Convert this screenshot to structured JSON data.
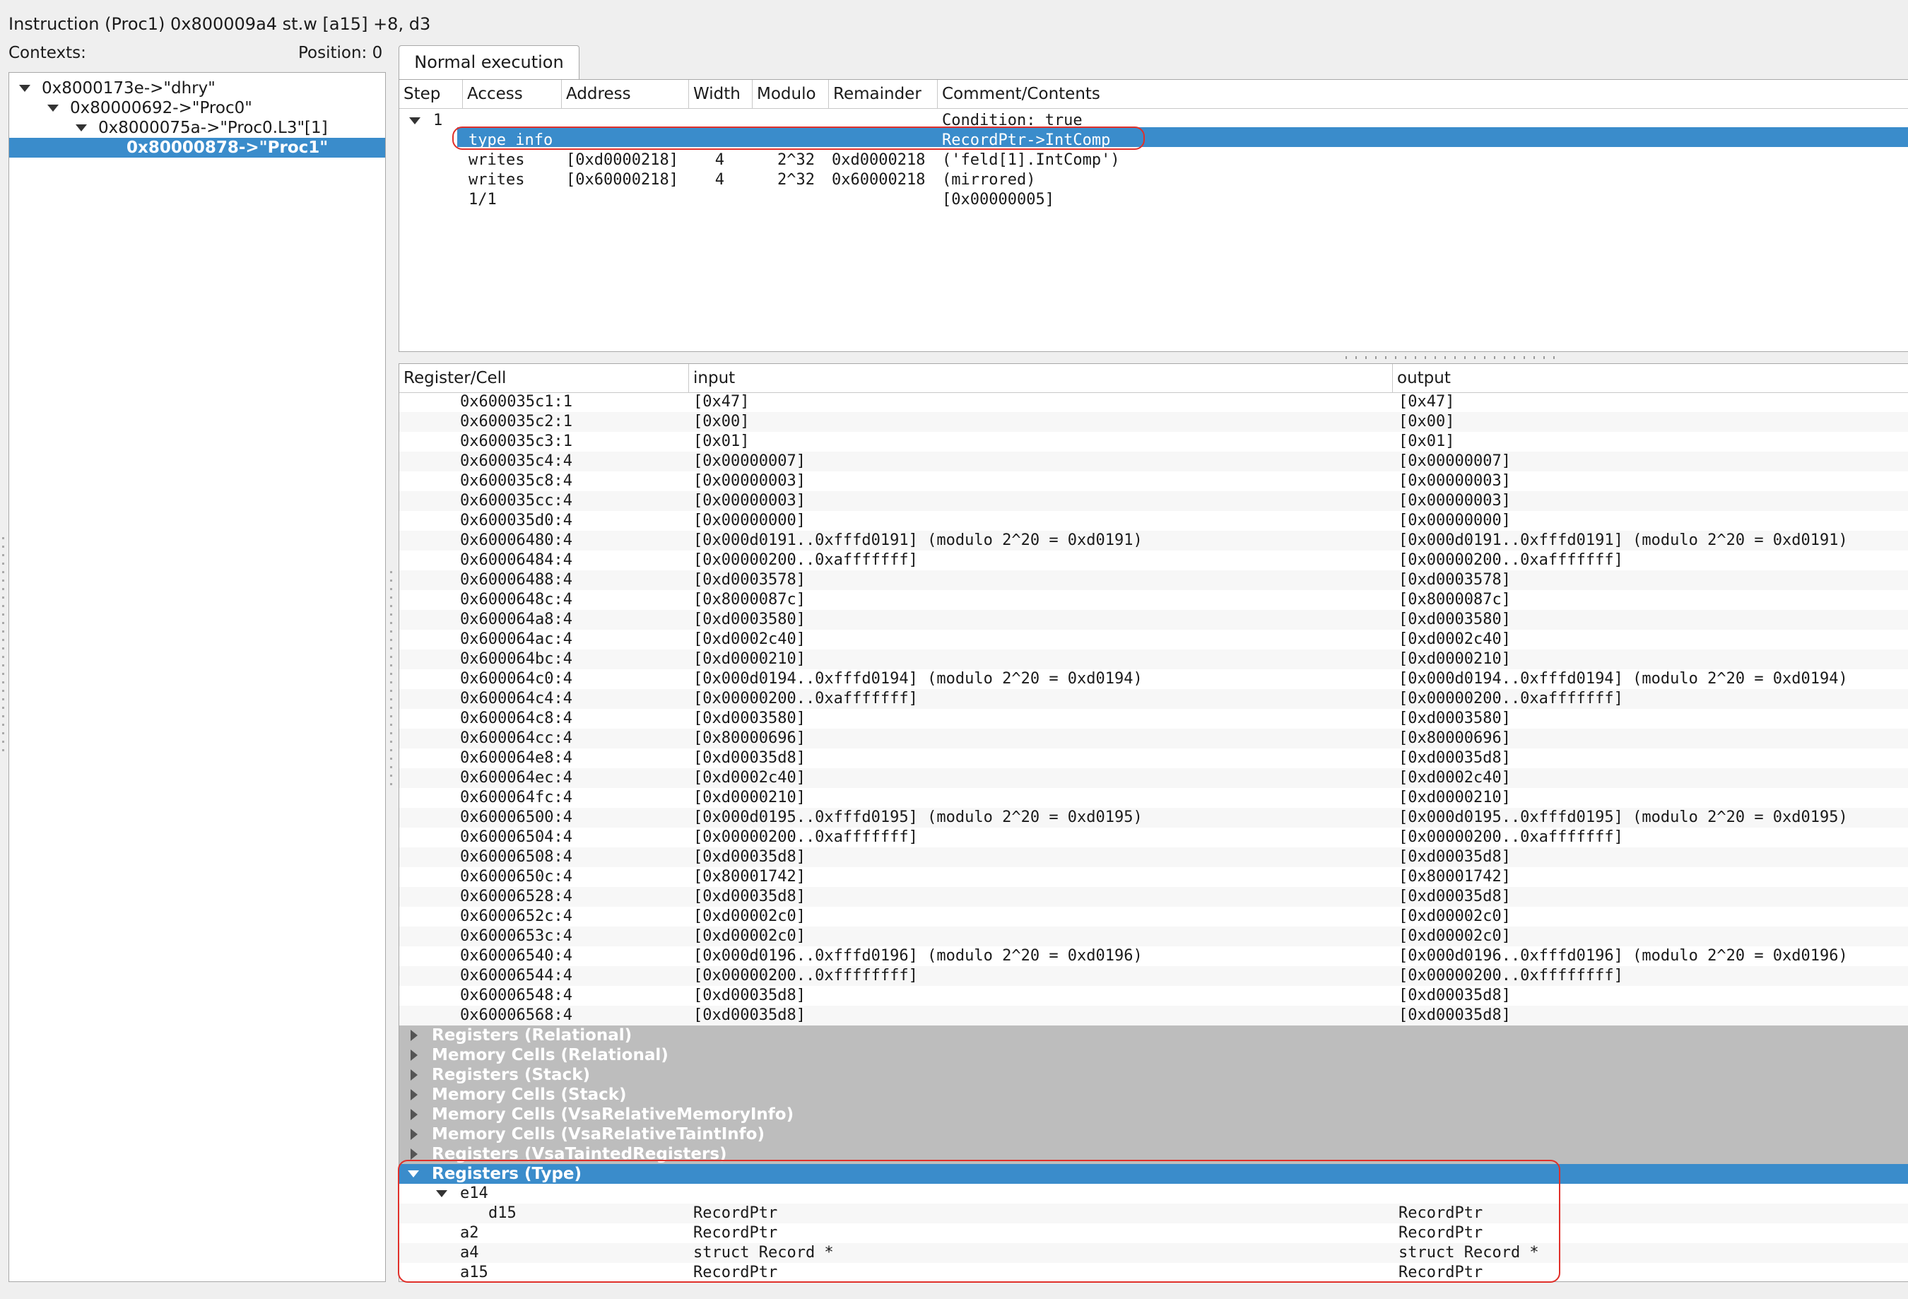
{
  "window": {
    "title": "Instruction (Proc1) 0x800009a4 st.w [a15] +8, d3",
    "contexts_label": "Contexts:",
    "position_label": "Position: 0"
  },
  "contexts": [
    {
      "label": "0x8000173e->\"dhry\"",
      "depth": 0,
      "expanded": true,
      "selected": false
    },
    {
      "label": "0x80000692->\"Proc0\"",
      "depth": 1,
      "expanded": true,
      "selected": false
    },
    {
      "label": "0x8000075a->\"Proc0.L3\"[1]",
      "depth": 2,
      "expanded": true,
      "selected": false
    },
    {
      "label": "0x80000878->\"Proc1\"",
      "depth": 3,
      "expanded": false,
      "selected": true
    }
  ],
  "tab": {
    "label": "Normal execution"
  },
  "steps_table": {
    "headers": [
      "Step",
      "Access",
      "Address",
      "Width",
      "Modulo",
      "Remainder",
      "Comment/Contents"
    ],
    "rows": [
      {
        "step": "1",
        "access": "",
        "address": "",
        "width": "",
        "modulo": "",
        "remainder": "",
        "comment": "Condition: true",
        "expanded": true,
        "selected": false
      },
      {
        "step": "",
        "access": "type info",
        "address": "",
        "width": "",
        "modulo": "",
        "remainder": "",
        "comment": "RecordPtr->IntComp",
        "selected": true
      },
      {
        "step": "",
        "access": "writes",
        "address": "[0xd0000218]",
        "width": "4",
        "modulo": "2^32",
        "remainder": "0xd0000218",
        "comment": "('feld[1].IntComp')",
        "selected": false
      },
      {
        "step": "",
        "access": "writes",
        "address": "[0x60000218]",
        "width": "4",
        "modulo": "2^32",
        "remainder": "0x60000218",
        "comment": "(mirrored)",
        "selected": false
      },
      {
        "step": "",
        "access": "1/1",
        "address": "",
        "width": "",
        "modulo": "",
        "remainder": "",
        "comment": "[0x00000005]",
        "selected": false
      }
    ]
  },
  "reg_table": {
    "headers": [
      "Register/Cell",
      "input",
      "output"
    ],
    "rows": [
      {
        "cell": "0x600035c1:1",
        "input": "[0x47]",
        "output": "[0x47]"
      },
      {
        "cell": "0x600035c2:1",
        "input": "[0x00]",
        "output": "[0x00]"
      },
      {
        "cell": "0x600035c3:1",
        "input": "[0x01]",
        "output": "[0x01]"
      },
      {
        "cell": "0x600035c4:4",
        "input": "[0x00000007]",
        "output": "[0x00000007]"
      },
      {
        "cell": "0x600035c8:4",
        "input": "[0x00000003]",
        "output": "[0x00000003]"
      },
      {
        "cell": "0x600035cc:4",
        "input": "[0x00000003]",
        "output": "[0x00000003]"
      },
      {
        "cell": "0x600035d0:4",
        "input": "[0x00000000]",
        "output": "[0x00000000]"
      },
      {
        "cell": "0x60006480:4",
        "input": "[0x000d0191..0xfffd0191] (modulo 2^20 = 0xd0191)",
        "output": "[0x000d0191..0xfffd0191] (modulo 2^20 = 0xd0191)"
      },
      {
        "cell": "0x60006484:4",
        "input": "[0x00000200..0xafffffff]",
        "output": "[0x00000200..0xafffffff]"
      },
      {
        "cell": "0x60006488:4",
        "input": "[0xd0003578]",
        "output": "[0xd0003578]"
      },
      {
        "cell": "0x6000648c:4",
        "input": "[0x8000087c]",
        "output": "[0x8000087c]"
      },
      {
        "cell": "0x600064a8:4",
        "input": "[0xd0003580]",
        "output": "[0xd0003580]"
      },
      {
        "cell": "0x600064ac:4",
        "input": "[0xd0002c40]",
        "output": "[0xd0002c40]"
      },
      {
        "cell": "0x600064bc:4",
        "input": "[0xd0000210]",
        "output": "[0xd0000210]"
      },
      {
        "cell": "0x600064c0:4",
        "input": "[0x000d0194..0xfffd0194] (modulo 2^20 = 0xd0194)",
        "output": "[0x000d0194..0xfffd0194] (modulo 2^20 = 0xd0194)"
      },
      {
        "cell": "0x600064c4:4",
        "input": "[0x00000200..0xafffffff]",
        "output": "[0x00000200..0xafffffff]"
      },
      {
        "cell": "0x600064c8:4",
        "input": "[0xd0003580]",
        "output": "[0xd0003580]"
      },
      {
        "cell": "0x600064cc:4",
        "input": "[0x80000696]",
        "output": "[0x80000696]"
      },
      {
        "cell": "0x600064e8:4",
        "input": "[0xd00035d8]",
        "output": "[0xd00035d8]"
      },
      {
        "cell": "0x600064ec:4",
        "input": "[0xd0002c40]",
        "output": "[0xd0002c40]"
      },
      {
        "cell": "0x600064fc:4",
        "input": "[0xd0000210]",
        "output": "[0xd0000210]"
      },
      {
        "cell": "0x60006500:4",
        "input": "[0x000d0195..0xfffd0195] (modulo 2^20 = 0xd0195)",
        "output": "[0x000d0195..0xfffd0195] (modulo 2^20 = 0xd0195)"
      },
      {
        "cell": "0x60006504:4",
        "input": "[0x00000200..0xafffffff]",
        "output": "[0x00000200..0xafffffff]"
      },
      {
        "cell": "0x60006508:4",
        "input": "[0xd00035d8]",
        "output": "[0xd00035d8]"
      },
      {
        "cell": "0x6000650c:4",
        "input": "[0x80001742]",
        "output": "[0x80001742]"
      },
      {
        "cell": "0x60006528:4",
        "input": "[0xd00035d8]",
        "output": "[0xd00035d8]"
      },
      {
        "cell": "0x6000652c:4",
        "input": "[0xd00002c0]",
        "output": "[0xd00002c0]"
      },
      {
        "cell": "0x6000653c:4",
        "input": "[0xd00002c0]",
        "output": "[0xd00002c0]"
      },
      {
        "cell": "0x60006540:4",
        "input": "[0x000d0196..0xfffd0196] (modulo 2^20 = 0xd0196)",
        "output": "[0x000d0196..0xfffd0196] (modulo 2^20 = 0xd0196)"
      },
      {
        "cell": "0x60006544:4",
        "input": "[0x00000200..0xffffffff]",
        "output": "[0x00000200..0xffffffff]"
      },
      {
        "cell": "0x60006548:4",
        "input": "[0xd00035d8]",
        "output": "[0xd00035d8]"
      },
      {
        "cell": "0x60006568:4",
        "input": "[0xd00035d8]",
        "output": "[0xd00035d8]"
      }
    ],
    "groups": [
      "Registers (Relational)",
      "Memory Cells (Relational)",
      "Registers (Stack)",
      "Memory Cells (Stack)",
      "Memory Cells (VsaRelativeMemoryInfo)",
      "Memory Cells (VsaRelativeTaintInfo)",
      "Registers (VsaTaintedRegisters)"
    ],
    "type_group": {
      "label": "Registers (Type)",
      "rows": [
        {
          "cell": "e14",
          "input": "",
          "output": "",
          "depth": 0,
          "expanded": true
        },
        {
          "cell": "d15",
          "input": "RecordPtr",
          "output": "RecordPtr",
          "depth": 1
        },
        {
          "cell": "a2",
          "input": "RecordPtr",
          "output": "RecordPtr",
          "depth": 0
        },
        {
          "cell": "a4",
          "input": "struct Record *",
          "output": "struct Record *",
          "depth": 0
        },
        {
          "cell": "a15",
          "input": "RecordPtr",
          "output": "RecordPtr",
          "depth": 0
        }
      ]
    }
  },
  "colors": {
    "selection": "#3a8ccb",
    "group_header": "#bdbdbd",
    "annotation": "#e0302a"
  }
}
